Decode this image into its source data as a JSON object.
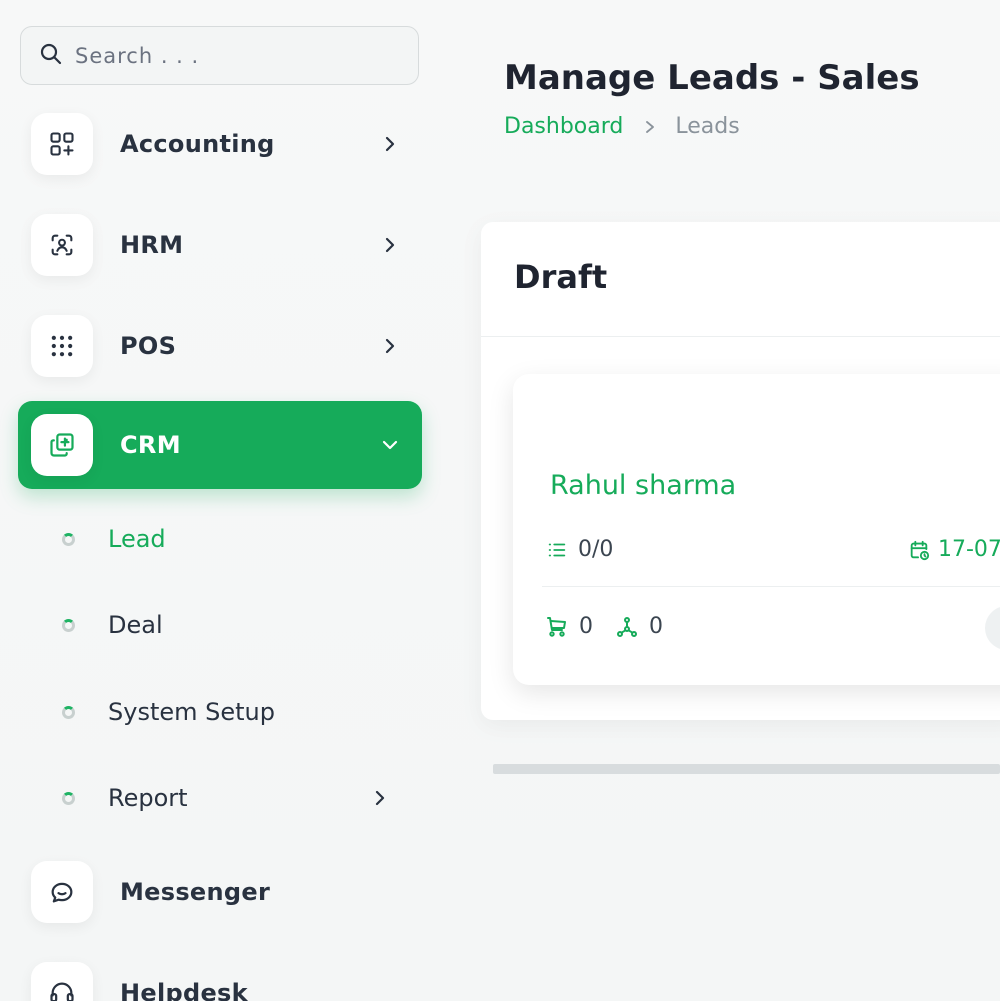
{
  "search": {
    "placeholder": "Search . . ."
  },
  "sidebar": {
    "items": [
      {
        "label": "Accounting",
        "icon": "apps-plus-icon"
      },
      {
        "label": "HRM",
        "icon": "user-scan-icon"
      },
      {
        "label": "POS",
        "icon": "grid-dots-icon"
      },
      {
        "label": "CRM",
        "icon": "layers-plus-icon",
        "active": true
      },
      {
        "label": "Messenger",
        "icon": "message-icon"
      },
      {
        "label": "Helpdesk",
        "icon": "headset-icon"
      }
    ],
    "crm_sub_items": [
      {
        "label": "Lead",
        "current": true
      },
      {
        "label": "Deal"
      },
      {
        "label": "System Setup"
      },
      {
        "label": "Report"
      }
    ]
  },
  "header": {
    "title": "Manage Leads - Sales",
    "breadcrumb": {
      "link": "Dashboard",
      "current": "Leads"
    }
  },
  "board": {
    "stage": "Draft",
    "lead": {
      "name": "Rahul sharma",
      "tasks": "0/0",
      "date": "17-07",
      "products": "0",
      "sources": "0"
    }
  },
  "colors": {
    "accent": "#16ab5a",
    "text": "#293240",
    "muted": "#8a939b"
  }
}
